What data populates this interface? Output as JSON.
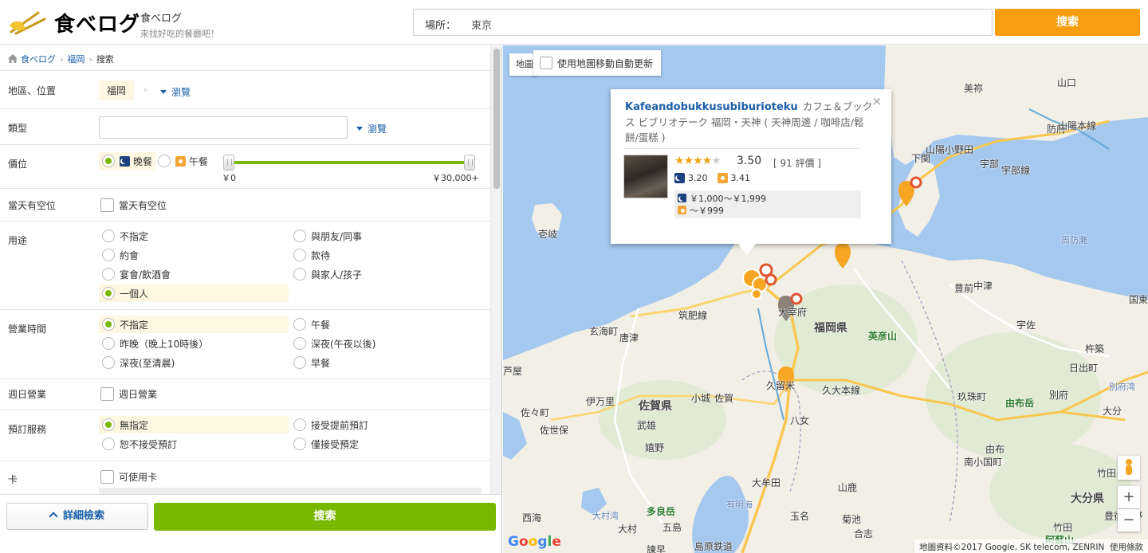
{
  "header": {
    "logo_text": "食べログ",
    "brand_name": "食べログ",
    "slogan": "來找好吃的餐廳吧！",
    "location_label": "場所：",
    "location_value": "東京",
    "search_label": "搜索"
  },
  "breadcrumb": {
    "items": [
      "食べログ",
      "福岡",
      "搜索"
    ]
  },
  "filters": {
    "area": {
      "label": "地區、位置",
      "value": "福岡",
      "browse": "瀏覽"
    },
    "category": {
      "label": "類型",
      "placeholder": "",
      "browse": "瀏覽"
    },
    "price": {
      "label": "價位",
      "dinner": "晚餐",
      "lunch": "午餐",
      "min_label": "￥0",
      "max_label": "￥30,000+",
      "range_min_fraction": 0,
      "range_max_fraction": 1
    },
    "availability": {
      "label": "當天有空位",
      "option": "當天有空位"
    },
    "purpose": {
      "label": "用途",
      "options": [
        "不指定",
        "與朋友/同事",
        "約會",
        "款待",
        "宴會/飲酒會",
        "與家人/孩子",
        "一個人"
      ],
      "selected": "一個人"
    },
    "hours": {
      "label": "營業時間",
      "options": [
        "不指定",
        "午餐",
        "昨晚（晚上10時後）",
        "深夜(午夜以後)",
        "深夜(至清晨)",
        "早餐"
      ],
      "selected": "不指定"
    },
    "sunday": {
      "label": "週日營業",
      "option": "週日營業"
    },
    "reservation": {
      "label": "預訂服務",
      "options": [
        "無指定",
        "接受提前預訂",
        "恕不接受預訂",
        "僅接受預定"
      ],
      "selected": "無指定"
    },
    "card": {
      "label": "卡",
      "option": "可使用卡"
    }
  },
  "bottom": {
    "advanced_label": "詳細檢索",
    "search_label": "搜索"
  },
  "map": {
    "type_label": "地圖",
    "auto_update_label": "使用地圖移動自動更新",
    "zoom_in": "+",
    "zoom_out": "−",
    "google_letters": [
      "G",
      "o",
      "o",
      "g",
      "l",
      "e"
    ],
    "attribution": "地圖資料©2017 Google, SK telecom, ZENRIN",
    "terms": "使用條款",
    "places": [
      {
        "name": "山口",
        "cls": ""
      },
      {
        "name": "美祢",
        "cls": ""
      },
      {
        "name": "防府",
        "cls": ""
      },
      {
        "name": "山陽小野田",
        "cls": ""
      },
      {
        "name": "下関",
        "cls": ""
      },
      {
        "name": "宇部",
        "cls": ""
      },
      {
        "name": "壱岐",
        "cls": ""
      },
      {
        "name": "中津",
        "cls": ""
      },
      {
        "name": "豊前",
        "cls": ""
      },
      {
        "name": "国東",
        "cls": ""
      },
      {
        "name": "福岡県",
        "cls": "big"
      },
      {
        "name": "英彦山",
        "cls": "green"
      },
      {
        "name": "宇佐",
        "cls": ""
      },
      {
        "name": "杵築",
        "cls": ""
      },
      {
        "name": "日出町",
        "cls": ""
      },
      {
        "name": "唐津",
        "cls": ""
      },
      {
        "name": "玄海町",
        "cls": ""
      },
      {
        "name": "伊万里",
        "cls": ""
      },
      {
        "name": "佐賀県",
        "cls": "big"
      },
      {
        "name": "小城",
        "cls": ""
      },
      {
        "name": "佐賀",
        "cls": ""
      },
      {
        "name": "久留米",
        "cls": ""
      },
      {
        "name": "玖珠町",
        "cls": ""
      },
      {
        "name": "由布岳",
        "cls": "green"
      },
      {
        "name": "別府",
        "cls": ""
      },
      {
        "name": "大分",
        "cls": ""
      },
      {
        "name": "佐々町",
        "cls": ""
      },
      {
        "name": "佐世保",
        "cls": ""
      },
      {
        "name": "武雄",
        "cls": ""
      },
      {
        "name": "嬉野",
        "cls": ""
      },
      {
        "name": "八女",
        "cls": ""
      },
      {
        "name": "竹田",
        "cls": ""
      },
      {
        "name": "由布",
        "cls": ""
      },
      {
        "name": "南小国町",
        "cls": ""
      },
      {
        "name": "大牟田",
        "cls": ""
      },
      {
        "name": "多良岳",
        "cls": "green"
      },
      {
        "name": "山鹿",
        "cls": ""
      },
      {
        "name": "西海",
        "cls": ""
      },
      {
        "name": "大村",
        "cls": ""
      },
      {
        "name": "玉名",
        "cls": ""
      },
      {
        "name": "菊池",
        "cls": ""
      },
      {
        "name": "大分県",
        "cls": "big"
      },
      {
        "name": "豊後大野",
        "cls": ""
      },
      {
        "name": "竹田",
        "cls": ""
      },
      {
        "name": "合志",
        "cls": ""
      },
      {
        "name": "大宰府",
        "cls": ""
      },
      {
        "name": "筑肥線",
        "cls": ""
      },
      {
        "name": "久大本線",
        "cls": ""
      },
      {
        "name": "山陽本線",
        "cls": ""
      },
      {
        "name": "宇部線",
        "cls": ""
      },
      {
        "name": "周防灘",
        "cls": "sea"
      },
      {
        "name": "別府湾",
        "cls": "sea"
      },
      {
        "name": "有明海",
        "cls": "sea"
      },
      {
        "name": "大村湾",
        "cls": "sea"
      },
      {
        "name": "阿蘇山",
        "cls": "green"
      },
      {
        "name": "諫早",
        "cls": ""
      },
      {
        "name": "島原鉄道",
        "cls": ""
      },
      {
        "name": "五島",
        "cls": ""
      },
      {
        "name": "芦屋",
        "cls": ""
      }
    ]
  },
  "popup": {
    "name": "Kafeandobukkusubiburioteku",
    "details": "カフェ＆ブックス ビブリオテーク 福岡・天神 ( 天神周邊 / 咖啡店/鬆餅/蛋糕 )",
    "close": "×",
    "rating": "3.50",
    "stars": 3.5,
    "reviews": "[ 91  評價 ]",
    "dinner_score": "3.20",
    "lunch_score": "3.41",
    "dinner_price": "￥1,000～￥1,999",
    "lunch_price": "～￥999"
  },
  "colors": {
    "accent_orange": "#f89d0f",
    "accent_green": "#7ab800",
    "link_blue": "#1a5fa8",
    "highlight": "#fdf6e0"
  }
}
